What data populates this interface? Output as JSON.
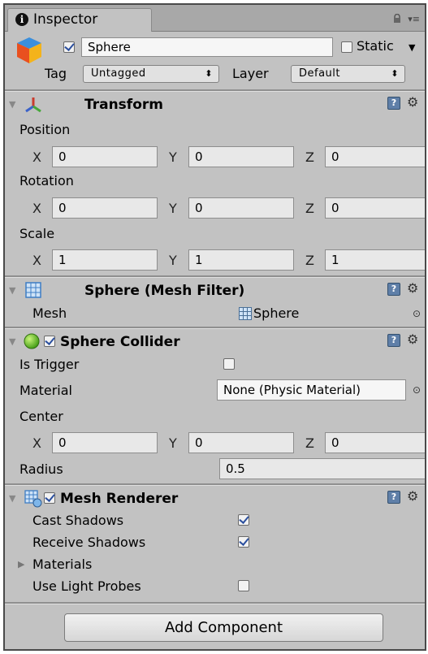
{
  "tab": {
    "label": "Inspector"
  },
  "object": {
    "name": "Sphere",
    "static_label": "Static",
    "tag_label": "Tag",
    "tag_value": "Untagged",
    "layer_label": "Layer",
    "layer_value": "Default",
    "active": true,
    "static": false
  },
  "transform": {
    "title": "Transform",
    "position_label": "Position",
    "rotation_label": "Rotation",
    "scale_label": "Scale",
    "x_label": "X",
    "y_label": "Y",
    "z_label": "Z",
    "position": {
      "x": "0",
      "y": "0",
      "z": "0"
    },
    "rotation": {
      "x": "0",
      "y": "0",
      "z": "0"
    },
    "scale": {
      "x": "1",
      "y": "1",
      "z": "1"
    }
  },
  "mesh_filter": {
    "title": "Sphere (Mesh Filter)",
    "mesh_label": "Mesh",
    "mesh_value": "Sphere"
  },
  "sphere_collider": {
    "title": "Sphere Collider",
    "enabled": true,
    "is_trigger_label": "Is Trigger",
    "is_trigger": false,
    "material_label": "Material",
    "material_value": "None (Physic Material)",
    "center_label": "Center",
    "center": {
      "x": "0",
      "y": "0",
      "z": "0"
    },
    "radius_label": "Radius",
    "radius": "0.5"
  },
  "mesh_renderer": {
    "title": "Mesh Renderer",
    "enabled": true,
    "cast_shadows_label": "Cast Shadows",
    "cast_shadows": true,
    "receive_shadows_label": "Receive Shadows",
    "receive_shadows": true,
    "materials_label": "Materials",
    "light_probes_label": "Use Light Probes",
    "light_probes": false
  },
  "add_component": {
    "label": "Add Component"
  },
  "icons": [
    "info-icon",
    "lock-icon",
    "menu-icon",
    "gameobject-cube-icon",
    "transform-axes-icon",
    "mesh-filter-icon",
    "collider-sphere-icon",
    "mesh-renderer-icon",
    "help-icon",
    "gear-icon",
    "object-picker-icon"
  ],
  "colors": {
    "panel_bg": "#c2c2c2",
    "field_bg": "#e8e8e8",
    "check_mark": "#2b4f9e",
    "help_icon": "#5f7fa8"
  }
}
